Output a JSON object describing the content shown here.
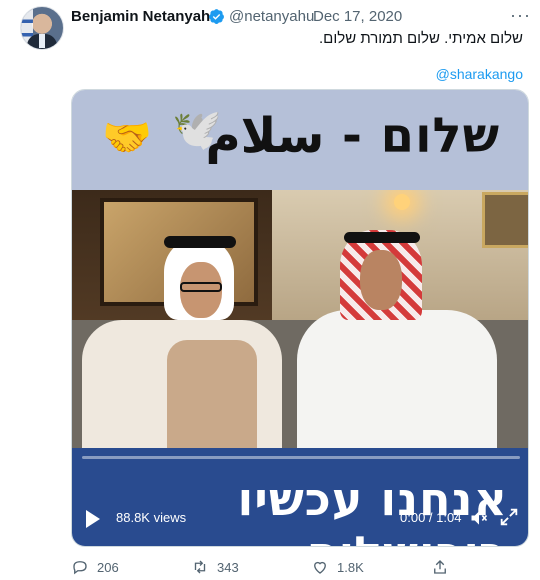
{
  "author": {
    "name": "Benjamin Netanyahu",
    "handle": "@netanyahu",
    "separator": "·",
    "date": "Dec 17, 2020",
    "verified": true
  },
  "menu_icon": "more-horizontal-icon",
  "tweet": {
    "text": "שלום אמיתי. שלום תמורת שלום.",
    "mention": "@sharakango"
  },
  "media": {
    "header_text": "שלום - سلام",
    "header_emojis": [
      "🤝",
      "🕊️"
    ],
    "subtitle_text": "אנחנו עכשיו בירושלים",
    "views": "88.8K views",
    "time": "0:00 / 1:04",
    "progress_fraction": 0.0
  },
  "actions": {
    "reply_count": "206",
    "retweet_count": "343",
    "like_count": "1.8K",
    "reply_icon": "reply-icon",
    "retweet_icon": "retweet-icon",
    "like_icon": "heart-icon",
    "share_icon": "share-icon"
  },
  "colors": {
    "accent": "#1d9bf0",
    "muted": "#536471",
    "header_band": "#b5c0d8",
    "subtitle_band": "#294b8f"
  }
}
